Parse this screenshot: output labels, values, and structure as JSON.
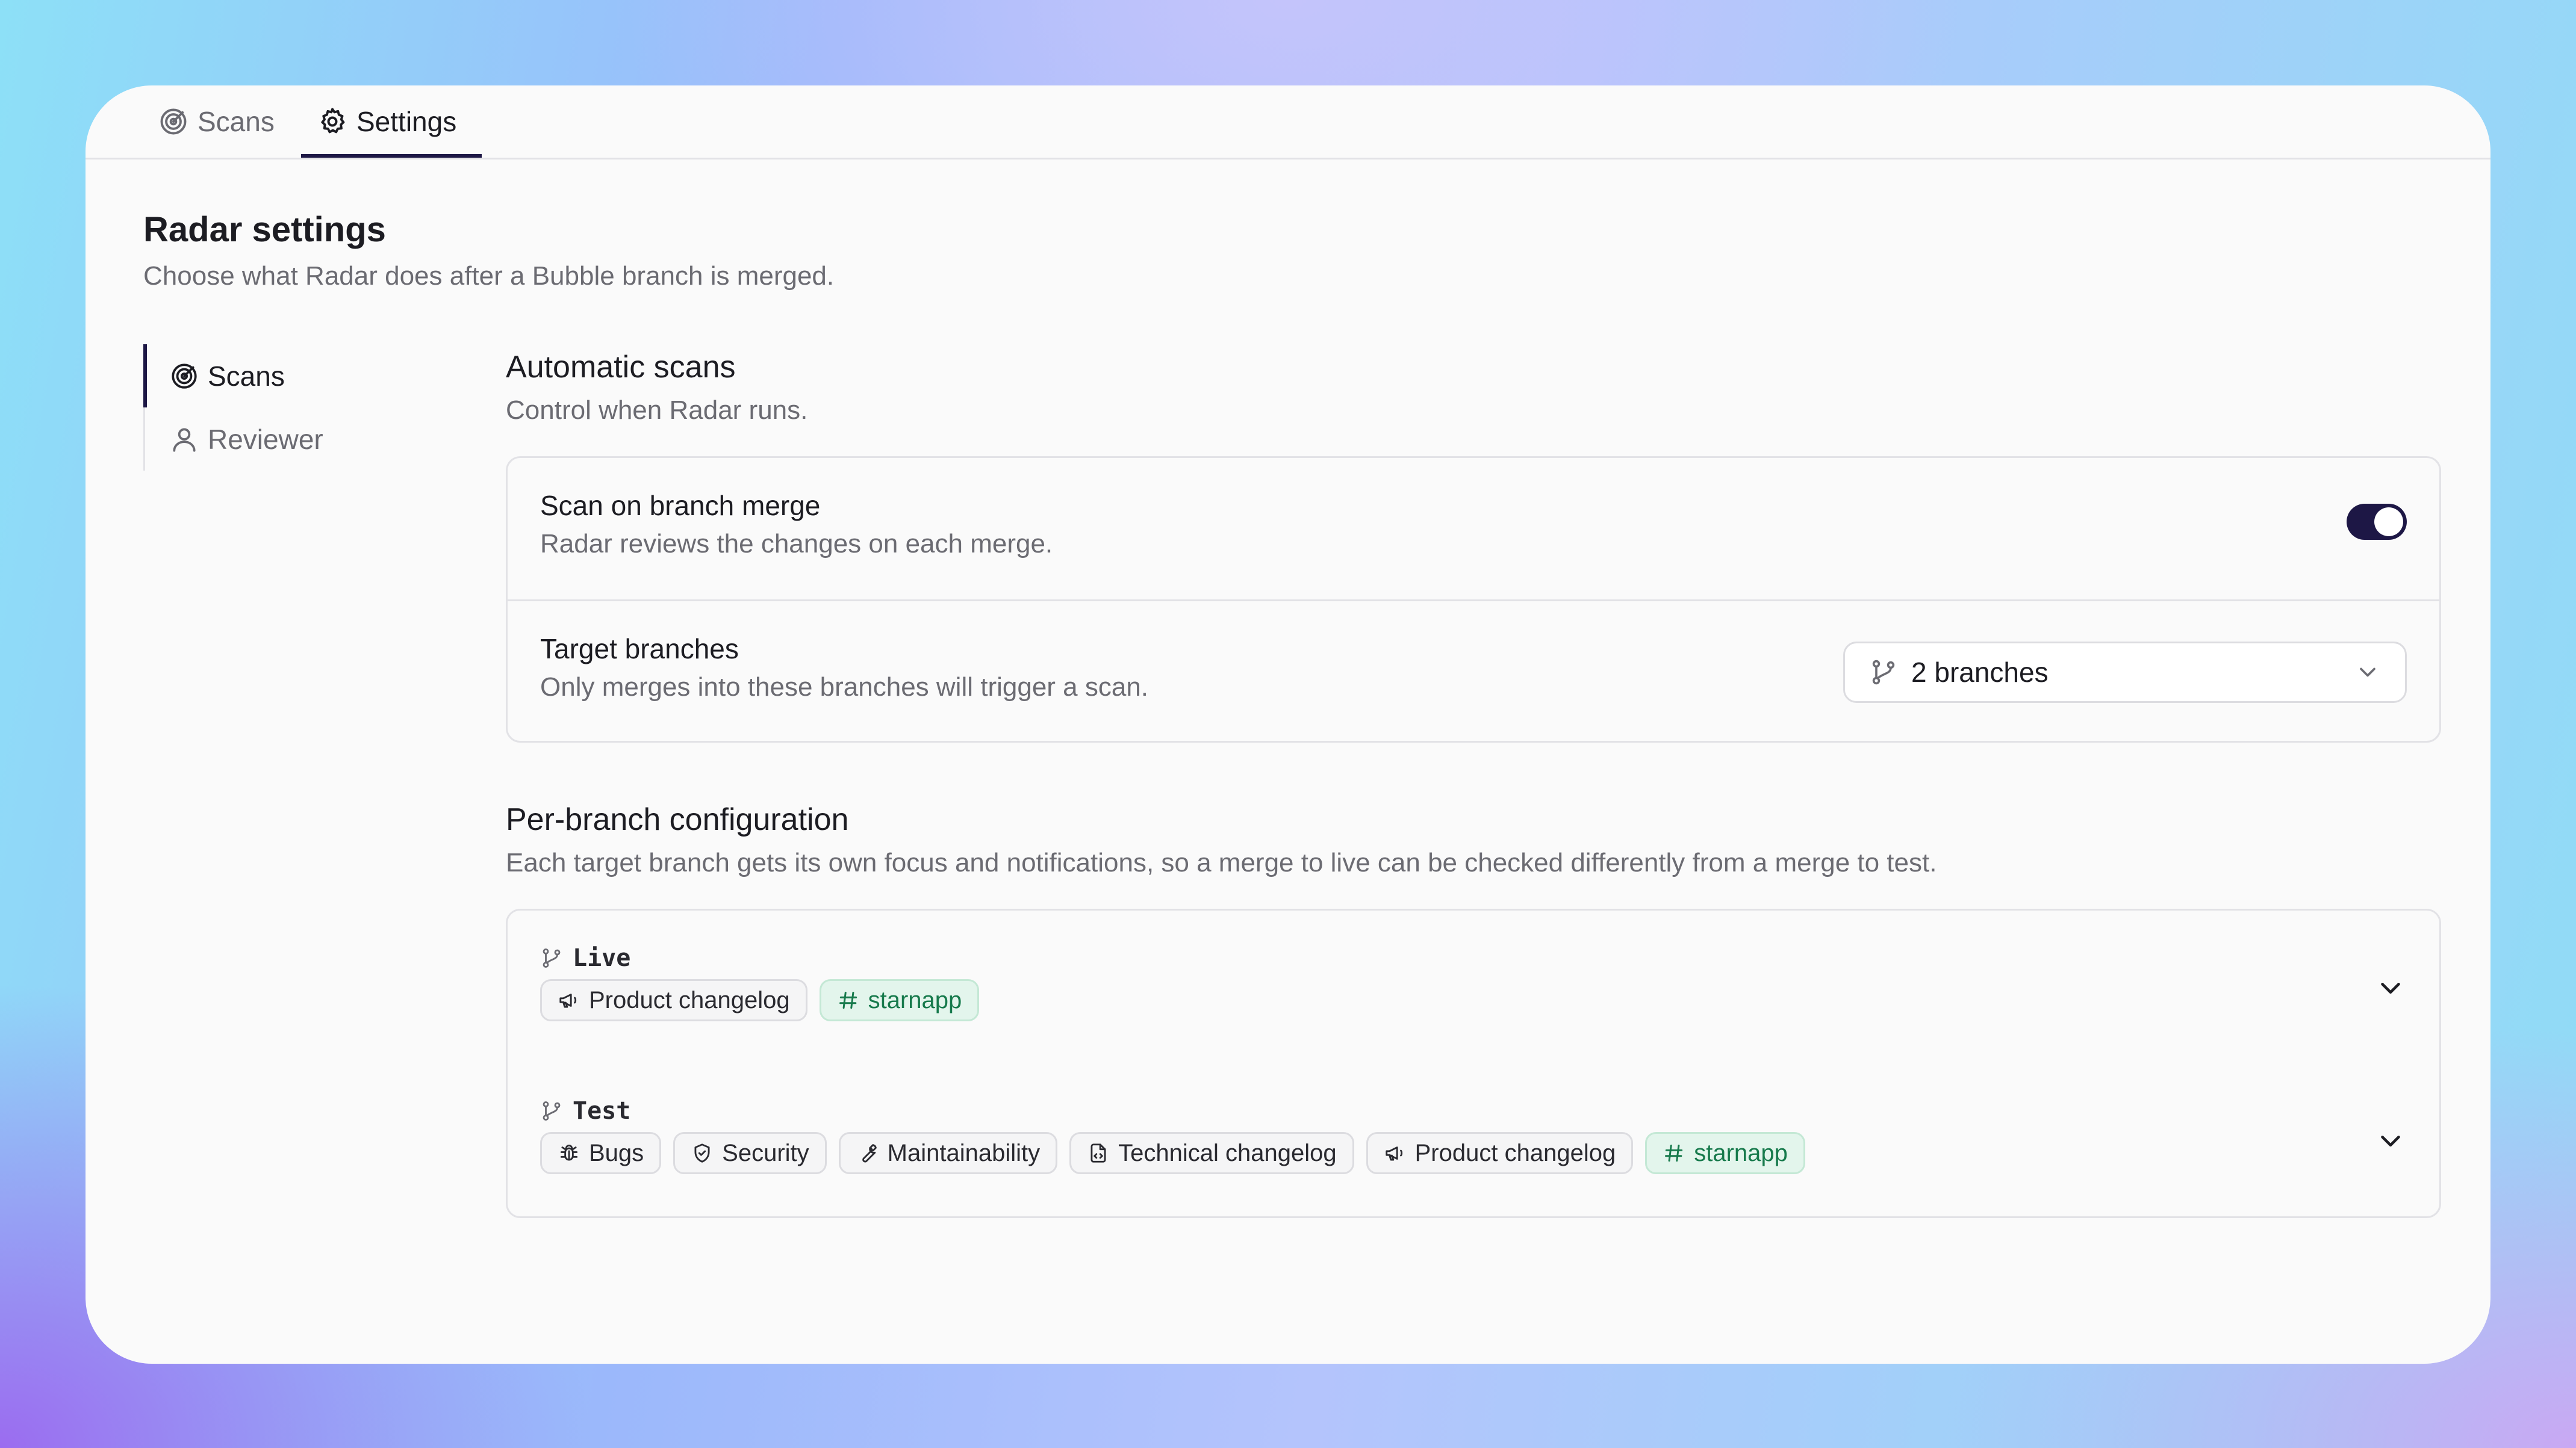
{
  "topnav": {
    "tabs": [
      {
        "label": "Scans",
        "icon": "radar-icon",
        "active": false
      },
      {
        "label": "Settings",
        "icon": "gear-icon",
        "active": true
      }
    ]
  },
  "page": {
    "title": "Radar settings",
    "subtitle": "Choose what Radar does after a Bubble branch is merged."
  },
  "sidebar": {
    "items": [
      {
        "label": "Scans",
        "icon": "radar-icon",
        "active": true
      },
      {
        "label": "Reviewer",
        "icon": "user-icon",
        "active": false
      }
    ]
  },
  "automatic": {
    "title": "Automatic scans",
    "subtitle": "Control when Radar runs.",
    "scan_on_merge": {
      "title": "Scan on branch merge",
      "subtitle": "Radar reviews the changes on each merge.",
      "enabled": true
    },
    "target_branches": {
      "title": "Target branches",
      "subtitle": "Only merges into these branches will trigger a scan.",
      "value": "2 branches"
    }
  },
  "per_branch": {
    "title": "Per-branch configuration",
    "subtitle": "Each target branch gets its own focus and notifications, so a merge to live can be checked differently from a merge to test.",
    "branches": [
      {
        "name": "Live",
        "chips": [
          {
            "label": "Product changelog",
            "icon": "megaphone-icon",
            "variant": "neutral"
          },
          {
            "label": "starnapp",
            "icon": "hash-icon",
            "variant": "green"
          }
        ]
      },
      {
        "name": "Test",
        "chips": [
          {
            "label": "Bugs",
            "icon": "bug-icon",
            "variant": "neutral"
          },
          {
            "label": "Security",
            "icon": "shield-icon",
            "variant": "neutral"
          },
          {
            "label": "Maintainability",
            "icon": "wrench-icon",
            "variant": "neutral"
          },
          {
            "label": "Technical changelog",
            "icon": "file-code-icon",
            "variant": "neutral"
          },
          {
            "label": "Product changelog",
            "icon": "megaphone-icon",
            "variant": "neutral"
          },
          {
            "label": "starnapp",
            "icon": "hash-icon",
            "variant": "green"
          }
        ]
      }
    ]
  },
  "colors": {
    "accent": "#1d1745",
    "text": "#1c1c22",
    "muted": "#6b6b72",
    "border": "#e2e2e6",
    "green_text": "#177a4c",
    "green_bg": "#e3f5ec"
  }
}
